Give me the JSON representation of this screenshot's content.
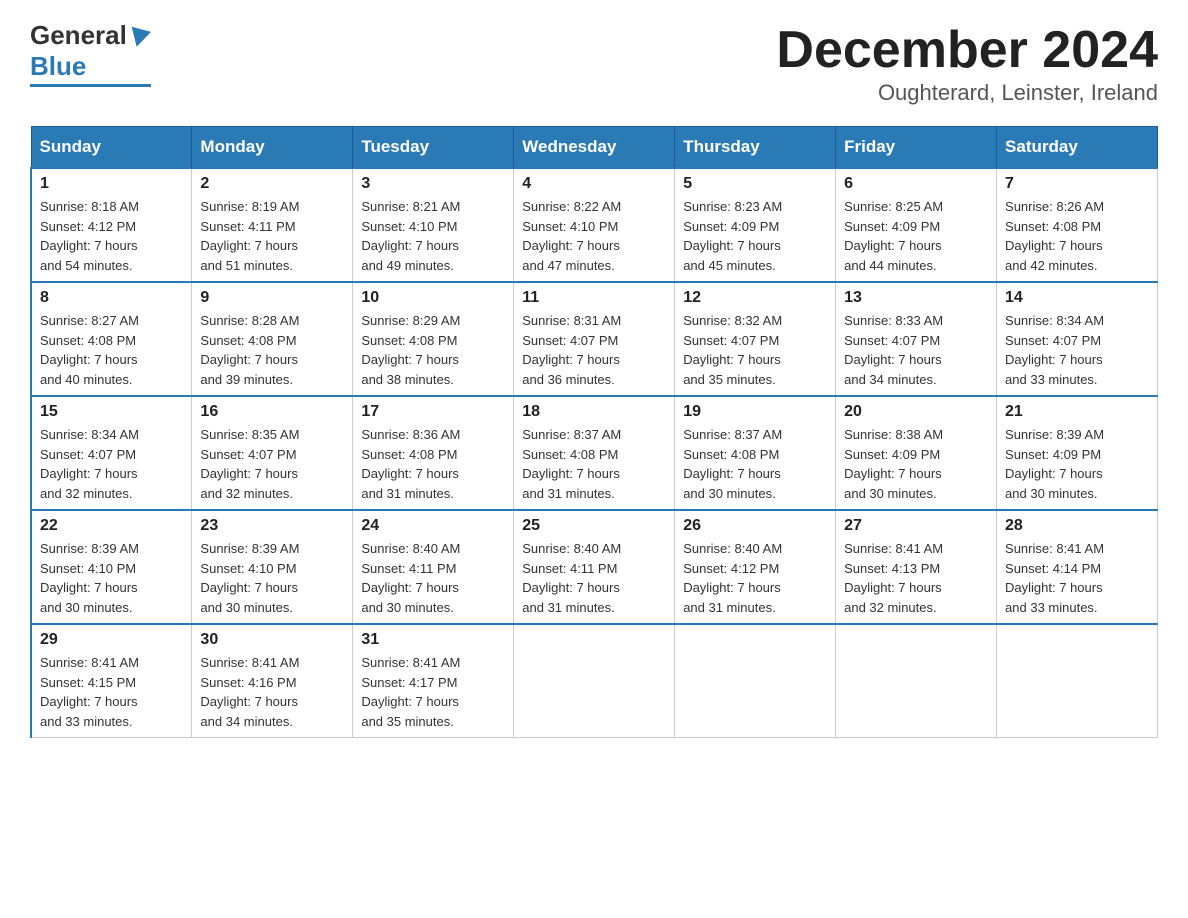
{
  "header": {
    "logo_general": "General",
    "logo_blue": "Blue",
    "month_title": "December 2024",
    "location": "Oughterard, Leinster, Ireland"
  },
  "days_of_week": [
    "Sunday",
    "Monday",
    "Tuesday",
    "Wednesday",
    "Thursday",
    "Friday",
    "Saturday"
  ],
  "weeks": [
    [
      {
        "day": "1",
        "sunrise": "8:18 AM",
        "sunset": "4:12 PM",
        "daylight": "7 hours and 54 minutes."
      },
      {
        "day": "2",
        "sunrise": "8:19 AM",
        "sunset": "4:11 PM",
        "daylight": "7 hours and 51 minutes."
      },
      {
        "day": "3",
        "sunrise": "8:21 AM",
        "sunset": "4:10 PM",
        "daylight": "7 hours and 49 minutes."
      },
      {
        "day": "4",
        "sunrise": "8:22 AM",
        "sunset": "4:10 PM",
        "daylight": "7 hours and 47 minutes."
      },
      {
        "day": "5",
        "sunrise": "8:23 AM",
        "sunset": "4:09 PM",
        "daylight": "7 hours and 45 minutes."
      },
      {
        "day": "6",
        "sunrise": "8:25 AM",
        "sunset": "4:09 PM",
        "daylight": "7 hours and 44 minutes."
      },
      {
        "day": "7",
        "sunrise": "8:26 AM",
        "sunset": "4:08 PM",
        "daylight": "7 hours and 42 minutes."
      }
    ],
    [
      {
        "day": "8",
        "sunrise": "8:27 AM",
        "sunset": "4:08 PM",
        "daylight": "7 hours and 40 minutes."
      },
      {
        "day": "9",
        "sunrise": "8:28 AM",
        "sunset": "4:08 PM",
        "daylight": "7 hours and 39 minutes."
      },
      {
        "day": "10",
        "sunrise": "8:29 AM",
        "sunset": "4:08 PM",
        "daylight": "7 hours and 38 minutes."
      },
      {
        "day": "11",
        "sunrise": "8:31 AM",
        "sunset": "4:07 PM",
        "daylight": "7 hours and 36 minutes."
      },
      {
        "day": "12",
        "sunrise": "8:32 AM",
        "sunset": "4:07 PM",
        "daylight": "7 hours and 35 minutes."
      },
      {
        "day": "13",
        "sunrise": "8:33 AM",
        "sunset": "4:07 PM",
        "daylight": "7 hours and 34 minutes."
      },
      {
        "day": "14",
        "sunrise": "8:34 AM",
        "sunset": "4:07 PM",
        "daylight": "7 hours and 33 minutes."
      }
    ],
    [
      {
        "day": "15",
        "sunrise": "8:34 AM",
        "sunset": "4:07 PM",
        "daylight": "7 hours and 32 minutes."
      },
      {
        "day": "16",
        "sunrise": "8:35 AM",
        "sunset": "4:07 PM",
        "daylight": "7 hours and 32 minutes."
      },
      {
        "day": "17",
        "sunrise": "8:36 AM",
        "sunset": "4:08 PM",
        "daylight": "7 hours and 31 minutes."
      },
      {
        "day": "18",
        "sunrise": "8:37 AM",
        "sunset": "4:08 PM",
        "daylight": "7 hours and 31 minutes."
      },
      {
        "day": "19",
        "sunrise": "8:37 AM",
        "sunset": "4:08 PM",
        "daylight": "7 hours and 30 minutes."
      },
      {
        "day": "20",
        "sunrise": "8:38 AM",
        "sunset": "4:09 PM",
        "daylight": "7 hours and 30 minutes."
      },
      {
        "day": "21",
        "sunrise": "8:39 AM",
        "sunset": "4:09 PM",
        "daylight": "7 hours and 30 minutes."
      }
    ],
    [
      {
        "day": "22",
        "sunrise": "8:39 AM",
        "sunset": "4:10 PM",
        "daylight": "7 hours and 30 minutes."
      },
      {
        "day": "23",
        "sunrise": "8:39 AM",
        "sunset": "4:10 PM",
        "daylight": "7 hours and 30 minutes."
      },
      {
        "day": "24",
        "sunrise": "8:40 AM",
        "sunset": "4:11 PM",
        "daylight": "7 hours and 30 minutes."
      },
      {
        "day": "25",
        "sunrise": "8:40 AM",
        "sunset": "4:11 PM",
        "daylight": "7 hours and 31 minutes."
      },
      {
        "day": "26",
        "sunrise": "8:40 AM",
        "sunset": "4:12 PM",
        "daylight": "7 hours and 31 minutes."
      },
      {
        "day": "27",
        "sunrise": "8:41 AM",
        "sunset": "4:13 PM",
        "daylight": "7 hours and 32 minutes."
      },
      {
        "day": "28",
        "sunrise": "8:41 AM",
        "sunset": "4:14 PM",
        "daylight": "7 hours and 33 minutes."
      }
    ],
    [
      {
        "day": "29",
        "sunrise": "8:41 AM",
        "sunset": "4:15 PM",
        "daylight": "7 hours and 33 minutes."
      },
      {
        "day": "30",
        "sunrise": "8:41 AM",
        "sunset": "4:16 PM",
        "daylight": "7 hours and 34 minutes."
      },
      {
        "day": "31",
        "sunrise": "8:41 AM",
        "sunset": "4:17 PM",
        "daylight": "7 hours and 35 minutes."
      },
      null,
      null,
      null,
      null
    ]
  ],
  "labels": {
    "sunrise": "Sunrise:",
    "sunset": "Sunset:",
    "daylight": "Daylight:"
  }
}
